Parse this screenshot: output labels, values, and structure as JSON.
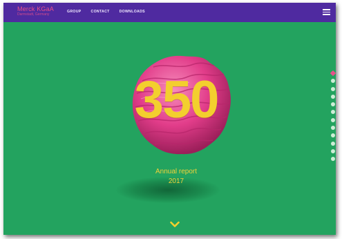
{
  "header": {
    "logo_name": "Merck KGaA",
    "logo_sub": "Darmstadt, Germany",
    "nav": [
      "GROUP",
      "CONTACT",
      "DOWNLOADS"
    ],
    "menu_icon": "hamburger-menu-icon"
  },
  "hero": {
    "number": "350",
    "report_title": "Annual report",
    "report_year": "2017",
    "scroll_icon": "chevron-down-icon"
  },
  "pagination": {
    "count": 12,
    "active_index": 0
  },
  "colors": {
    "background": "#23a35f",
    "topbar": "#4f2aa0",
    "accent_pink": "#e8508a",
    "accent_yellow": "#f3cf2e"
  }
}
